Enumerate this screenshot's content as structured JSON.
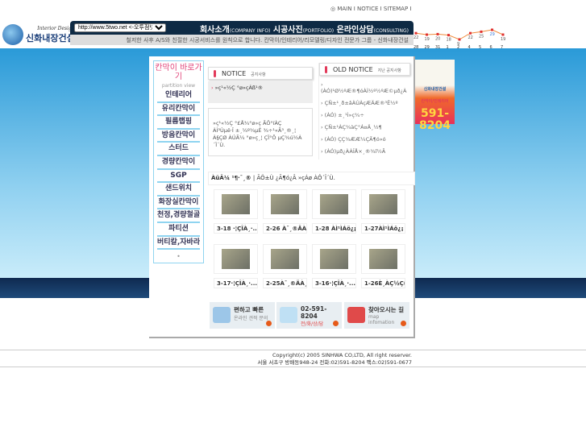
{
  "topnav": [
    "◎ MAIN",
    "NOTICE",
    "SITEMAP"
  ],
  "logo": {
    "sub": "Interior Design",
    "name": "신화내장건설"
  },
  "url_select": "http://www.5two.net <-오투점넷",
  "menus": [
    {
      "ko": "회사소개",
      "en": "(COMPANY INFO)"
    },
    {
      "ko": "시공사진",
      "en": "(PORTFOLIO)"
    },
    {
      "ko": "온라인상담",
      "en": "(CONSULTING)"
    }
  ],
  "slogan": "철저한 사후 A/S와 친절한 시공서비스를 원칙으로 합니다. 칸막이/인테리어/리모델링/디자인 전문가 그룹 - 신화내장건설",
  "visit_chart": {
    "dates": [
      "28",
      "29",
      "31",
      "1",
      "2",
      "4",
      "5",
      "6",
      "7"
    ],
    "values": [
      22,
      19,
      20,
      18,
      9,
      22,
      25,
      29,
      19
    ],
    "color": "#f08a3a"
  },
  "sidebar": {
    "title": "칸막이 바로가기",
    "subtitle": "partition view",
    "items": [
      "인테리어",
      "유리칸막이",
      "필름랩핑",
      "방음칸막이",
      "스터드",
      "경량칸막이",
      "SGP",
      "샌드위치",
      "화장실칸막이",
      "천정,경량철골",
      "파티션",
      "버티칼,자바라"
    ],
    "more": "•"
  },
  "notice": {
    "title": "NOTICE",
    "sub": "공지사항",
    "headline": "»ç¹«½Ç °ø»çÁß¹®",
    "body": "»ç¹«½Ç °£Å¾°ø»ç ÃÖ°íÀÇ ÀÌ³Ùµë·Î ±¸¼º¾µÉ ¾÷¹«Ã³¸®¸¦ À§ÇØ ÀÚÃ¼ °ø»ç¸¦ ÇÏ°Ô µÇ¾ú½À´Ï´Ù."
  },
  "old_notice": {
    "title": "OLD NOTICE",
    "sub": "지난 공지사항",
    "items": [
      "(ÀÓ)¹Ø½ºÆ®¶óÀÌ½º½ºÆ©µð¿À",
      "ÇÑ±¹¸ð±âÀÚÀçÆÄÆ®³Ê½º",
      "(ÀÓ) ±¸¹Ì»ç¾÷",
      "ÇÑ±¹ÀÇ¾àÇ°Á¤Ä¸½¶",
      "(ÀÓ) ÇÇ¾ÆÆ¼ÇÃ¶ó»ó",
      "(ÀÓ)µð¿ÀÀÎÅ×¸®¾î½Ã"
    ]
  },
  "ticker": {
    "label": "ÀüÃ¼ ¹¶·¯¸®",
    "text": "ÃÖ±Ù ¿Ã¶ó¿Â »çÁø ÀÔ´Ï´Ù."
  },
  "photos": [
    "3-18 ·¦ÇÎÀ¸·...",
    "2-26 À¯¸®ÄÀ¸·...",
    "1-28 ÀÌ¹ÌÁö¿¡",
    "1-27ÀÌ¹ÌÁö¿¡",
    "3-17·¦ÇÎÀ¸·...",
    "2-25À¯¸®ÄÀ¸·...",
    "3-16·¦ÇÎÀ¸·...",
    "1-26È¸ÀÇ½Ç(È..."
  ],
  "buttons": [
    {
      "title": "편하고 빠른",
      "sub": "온라인 견적 문의"
    },
    {
      "title": "02-591-8204",
      "sub": "전/화/상/담"
    },
    {
      "title": "찾아오시는 길",
      "sub": "map infomation"
    }
  ],
  "banner": {
    "company": "신화내장건설",
    "phone1": "591-",
    "phone2": "8204",
    "tag": "칸막이/인테리어"
  },
  "footer": {
    "copyright": "Copyright(c) 2005 SINHWA CO,LTD, All right reserver.",
    "address": "서울 서초구 방배동948-24 전화:02)591-8204 팩스:02)591-0677"
  }
}
